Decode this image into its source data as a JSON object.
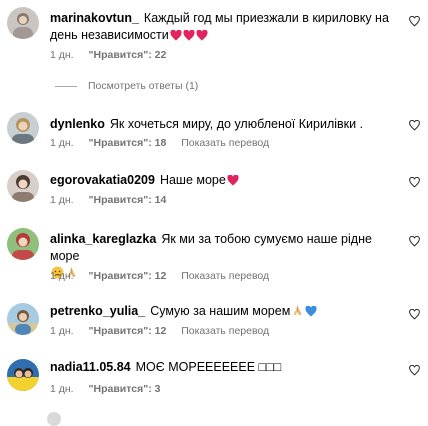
{
  "comments": [
    {
      "username": "marinakovtun_",
      "text": "Каждый год мы приезжали в кириловку на день независимости",
      "emojis": [
        "heart-red",
        "heart-red",
        "heart-red"
      ],
      "time": "1 дн.",
      "likes": "\"Нравится\": 22",
      "translate": ""
    },
    {
      "username": "dynlenko",
      "text": "Як хочеться миру, до улюбленої Кирилівки .",
      "emojis": [],
      "time": "1 дн.",
      "likes": "\"Нравится\": 18",
      "translate": "Показать перевод"
    },
    {
      "username": "egorovakatia0209",
      "text": "Наше море",
      "emojis": [
        "heart-red"
      ],
      "time": "1 дн.",
      "likes": "\"Нравится\": 14",
      "translate": ""
    },
    {
      "username": "alinka_kareglazka",
      "text": "Як ми за тобою сумуємо наше рідне море",
      "emojis": [
        "sad-face",
        "praying-hands"
      ],
      "time": "1 дн.",
      "likes": "\"Нравится\": 12",
      "translate": "Показать перевод"
    },
    {
      "username": "petrenko_yulia_",
      "text": "Сумую за нашим морем",
      "emojis": [
        "praying-hands",
        "heart-blue"
      ],
      "time": "1 дн.",
      "likes": "\"Нравится\": 12",
      "translate": "Показать перевод"
    },
    {
      "username": "nadia11.05.84",
      "text": "МОЄ МОРЕЕЕЕЕЕЕ □□□",
      "emojis": [],
      "time": "1 дн.",
      "likes": "\"Нравится\": 3",
      "translate": ""
    }
  ],
  "view_replies": "Посмотреть ответы (1)",
  "colors": {
    "meta_text": "#737373",
    "heart_emoji": "#e0245e",
    "blue_heart": "#3b8ede",
    "divider": "#a8a8a8"
  },
  "icons": {
    "like": "heart-outline-icon"
  }
}
